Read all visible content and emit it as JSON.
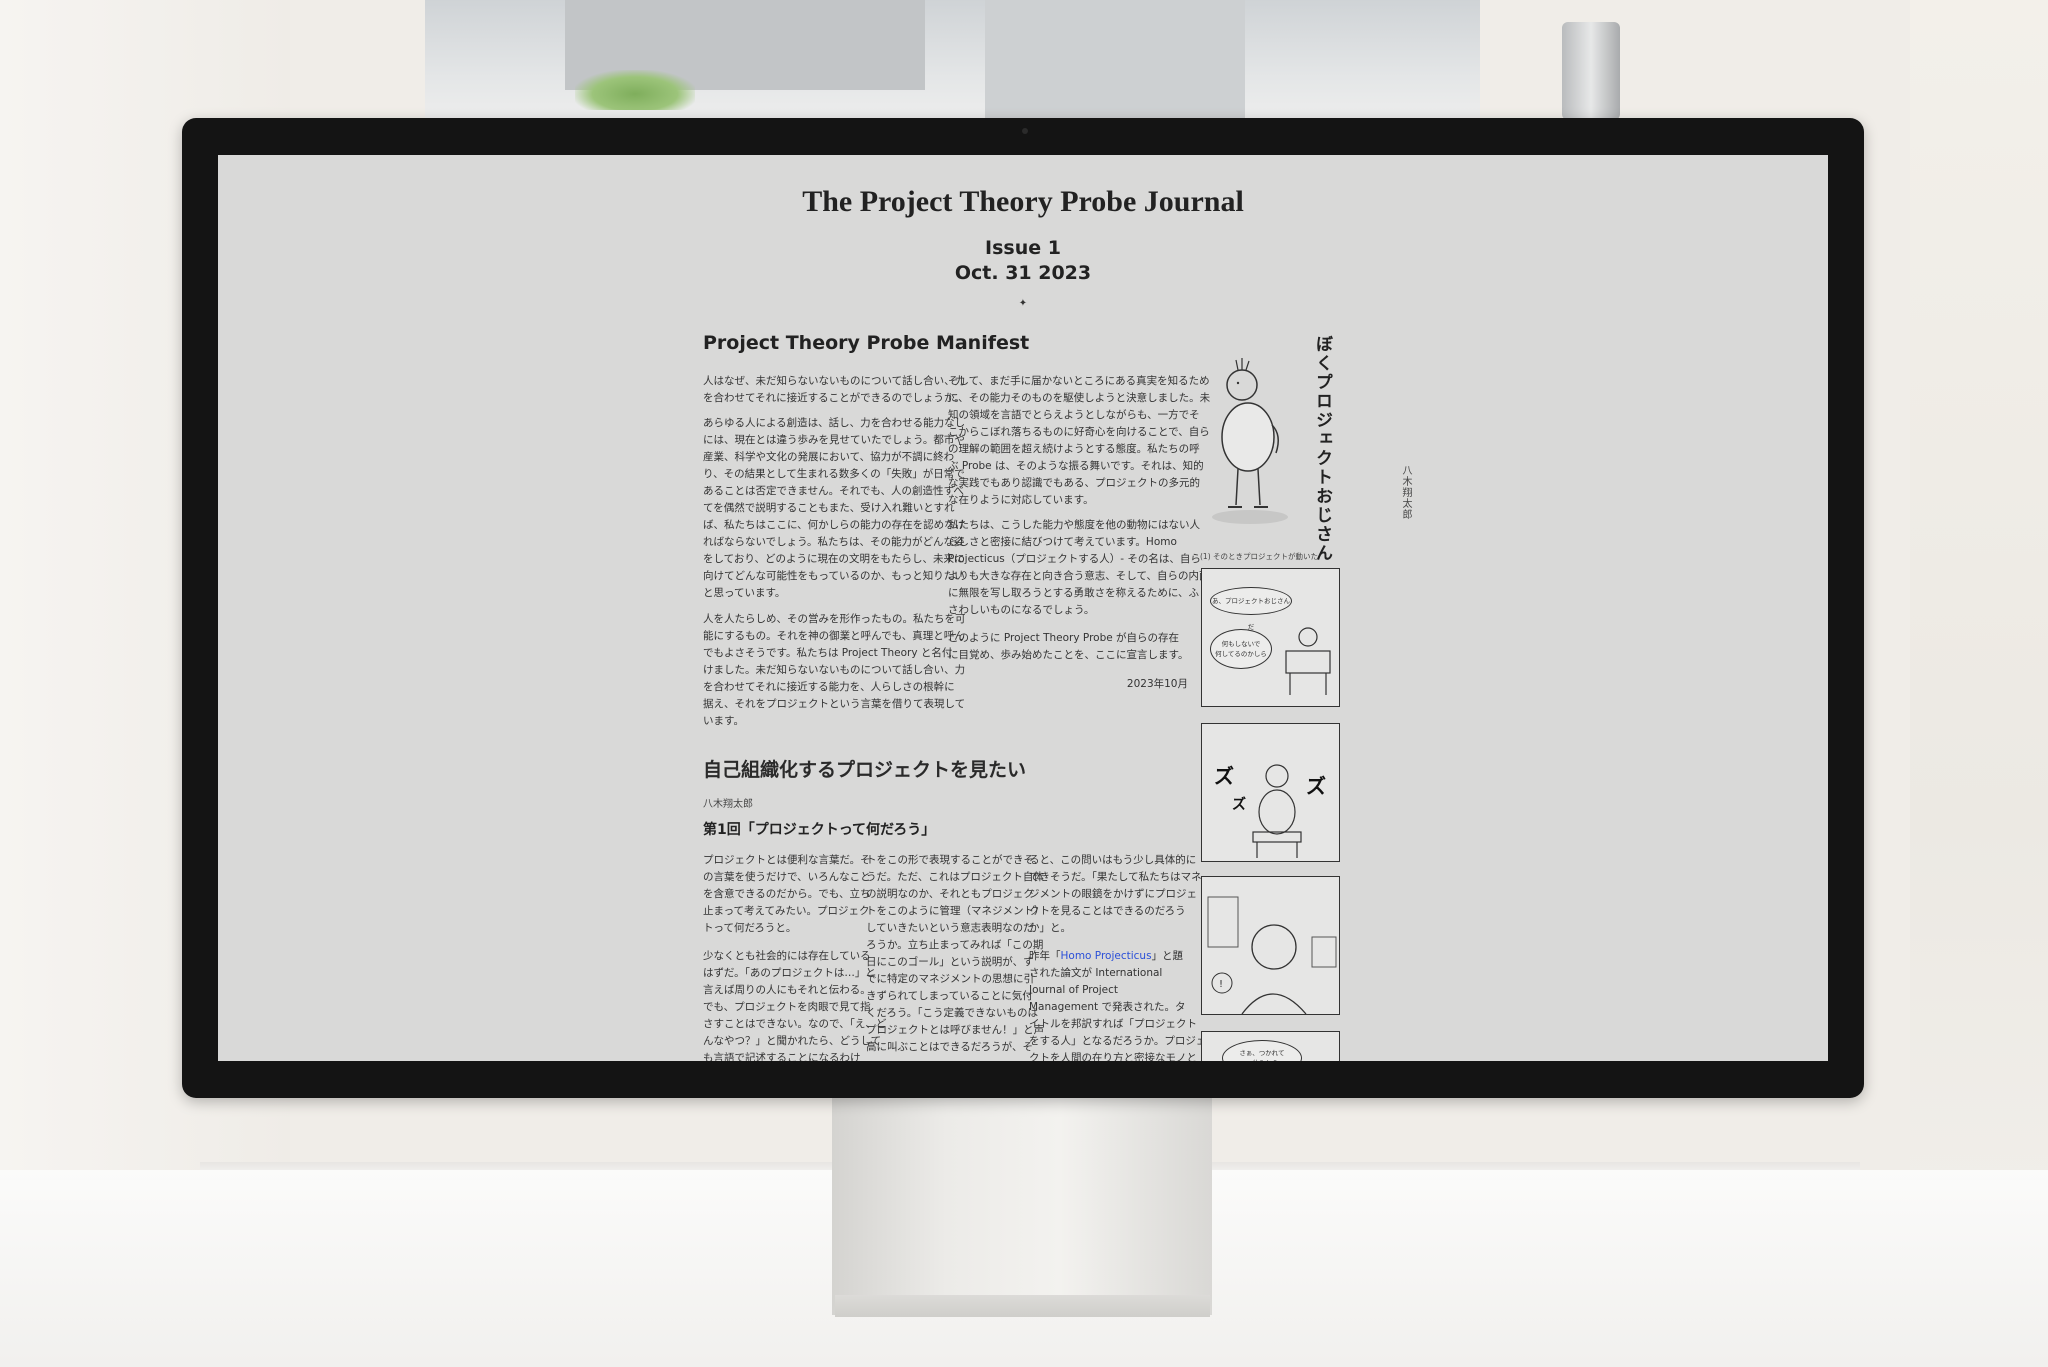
{
  "journal": {
    "title": "The Project Theory Probe Journal",
    "issue": "Issue 1",
    "date": "Oct. 31 2023",
    "divider": "✦"
  },
  "manifest": {
    "heading": "Project Theory Probe Manifest",
    "left_paragraphs": [
      "人はなぜ、未だ知らないないものについて話し合い、力\nを合わせてそれに接近することができるのでしょうか。",
      "あらゆる人による創造は、話し、力を合わせる能力なし\nには、現在とは違う歩みを見せていたでしょう。都市や\n産業、科学や文化の発展において、協力が不調に終わ\nり、その結果として生まれる数多くの「失敗」が日常で\nあることは否定できません。それでも、人の創造性すべ\nてを偶然で説明することもまた、受け入れ難いとすれ\nば、私たちはここに、何かしらの能力の存在を認めなけ\nればならないでしょう。私たちは、その能力がどんな姿\nをしており、どのように現在の文明をもたらし、未来に\n向けてどんな可能性をもっているのか、もっと知りたい\nと思っています。",
      "人を人たらしめ、その営みを形作ったもの。私たちを可\n能にするもの。それを神の御業と呼んでも、真理と呼ん\nでもよさそうです。私たちは Project Theory と名付\nけました。未だ知らないないものについて話し合い、力\nを合わせてそれに接近する能力を、人らしさの根幹に\n据え、それをプロジェクトという言葉を借りて表現して\nいます。"
    ],
    "right_paragraphs": [
      "そして、まだ手に届かないところにある真実を知るため\nに、その能力そのものを駆使しようと決意しました。未\n知の領域を言語でとらえようとしながらも、一方でそ\nこからこぼれ落ちるものに好奇心を向けることで、自ら\nの理解の範囲を超え続けようとする態度。私たちの呼\nぶ Probe は、そのような振る舞いです。それは、知的\nな実践でもあり認識でもある、プロジェクトの多元的\nな在りように対応しています。",
      "私たちは、こうした能力や態度を他の動物にはない人\nらしさと密接に結びつけて考えています。Homo\nProjecticus（プロジェクトする人）- その名は、自ら\nよりも大きな存在と向き合う意志、そして、自らの内面\nに無限を写し取ろうとする勇敢さを称えるために、ふ\nさわしいものになるでしょう。",
      "このように Project Theory Probe が自らの存在\nに目覚め、歩み始めたことを、ここに宣言します。"
    ],
    "signature": "2023年10月"
  },
  "article": {
    "heading": "自己組織化するプロジェクトを見たい",
    "author": "八木翔太郎",
    "part_title": "第1回「プロジェクトって何だろう」",
    "col1": [
      "プロジェクトとは便利な言葉だ。そ\nの言葉を使うだけで、いろんなこと\nを含意できるのだから。でも、立ち\n止まって考えてみたい。プロジェク\nトって何だろうと。",
      "少なくとも社会的には存在している\nはずだ。「あのプロジェクトは…」と\n言えば周りの人にもそれと伝わる。\nでも、プロジェクトを肉眼で見て指\nさすことはできない。なので、「え、ど\nんなやつ？」と聞かれたら、どうして\nも言語で記述することになるわけ"
    ],
    "col2": [
      "トをこの形で表現することができそ\nうだ。ただ、これはプロジェクト自体\nの説明なのか、それともプロジェク\nトをこのように管理（マネジメント）\nしていきたいという意志表明なのだ\nろうか。立ち止まってみれば「この期\n日にこのゴール」という説明が、す\nでに特定のマネジメントの思想に引\nきずられてしまっていることに気付\nくだろう。「こう定義できないものは\nプロジェクトとは呼びません！」と声\n高に叫ぶことはできるだろうが、そ"
    ],
    "col3_p1": "ると、この問いはもう少し具体的に\nできそうだ。「果たして私たちはマネ\nジメントの眼鏡をかけずにプロジェ\nクトを見ることはできるのだろう\nか」と。",
    "col3_p2": {
      "before": "昨年「",
      "link": "Homo Projecticus",
      "after": "」と題\nされた論文が International\nJournal of Project\nManagement で発表された。タ\nイトルを邦訳すれば「プロジェクト\nをする人」となるだろうか。プロジェ\nクトを人間の在り方と密接なモノと"
    }
  },
  "comic": {
    "vertical_title": "ぼくプロジェクトおじさん",
    "vertical_author": "八木翔太郎",
    "caption": "(1) そのときプロジェクトが動いた",
    "panel1_bubble1": "あ、プロジェクトおじさんだ",
    "panel1_bubble2": "何もしないで\n何してるのかしら",
    "panel2_sfx": "ズ",
    "panel4_text": "さぁ、つかれて\n一休みから"
  }
}
